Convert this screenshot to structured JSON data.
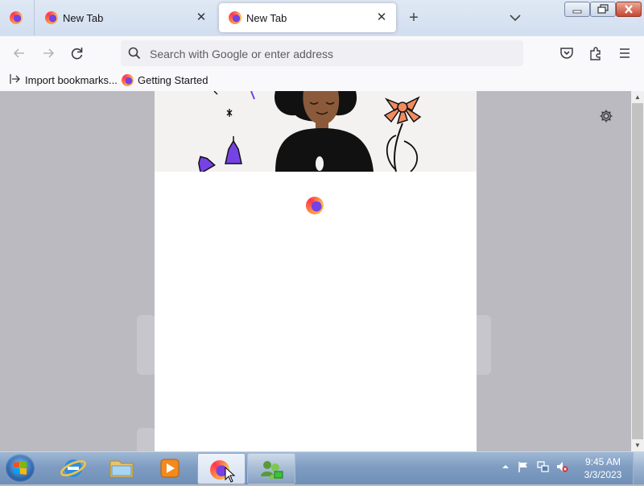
{
  "browser": {
    "tabs": [
      {
        "label": "New Tab",
        "active": false
      },
      {
        "label": "New Tab",
        "active": true
      }
    ],
    "new_tab_icon": "plus-icon",
    "list_all_tabs_icon": "chevron-down-icon",
    "window_controls": [
      "minimize-icon",
      "restore-icon",
      "close-icon"
    ]
  },
  "navbar": {
    "back_icon": "arrow-left-icon",
    "forward_icon": "arrow-right-icon",
    "reload_icon": "reload-icon",
    "address_placeholder": "Search with Google or enter address",
    "right_icons": [
      "pocket-icon",
      "extensions-icon",
      "menu-icon"
    ]
  },
  "bookmarks": [
    {
      "label": "Import bookmarks...",
      "icon": "import-icon"
    },
    {
      "label": "Getting Started",
      "icon": "firefox-icon"
    }
  ],
  "content": {
    "settings_icon": "gear-icon",
    "modal_logo": "firefox-icon"
  },
  "taskbar": {
    "pinned": [
      "internet-explorer-icon",
      "file-explorer-icon",
      "media-player-icon",
      "firefox-icon",
      "network-users-icon"
    ],
    "tray_icons": [
      "show-hidden-icon",
      "action-center-flag-icon",
      "network-icon",
      "volume-muted-icon"
    ],
    "time": "9:45 AM",
    "date": "3/3/2023"
  },
  "colors": {
    "accent": "#0061e0",
    "content_backdrop": "#babac0",
    "tab_bar": "#dfe8f4"
  }
}
